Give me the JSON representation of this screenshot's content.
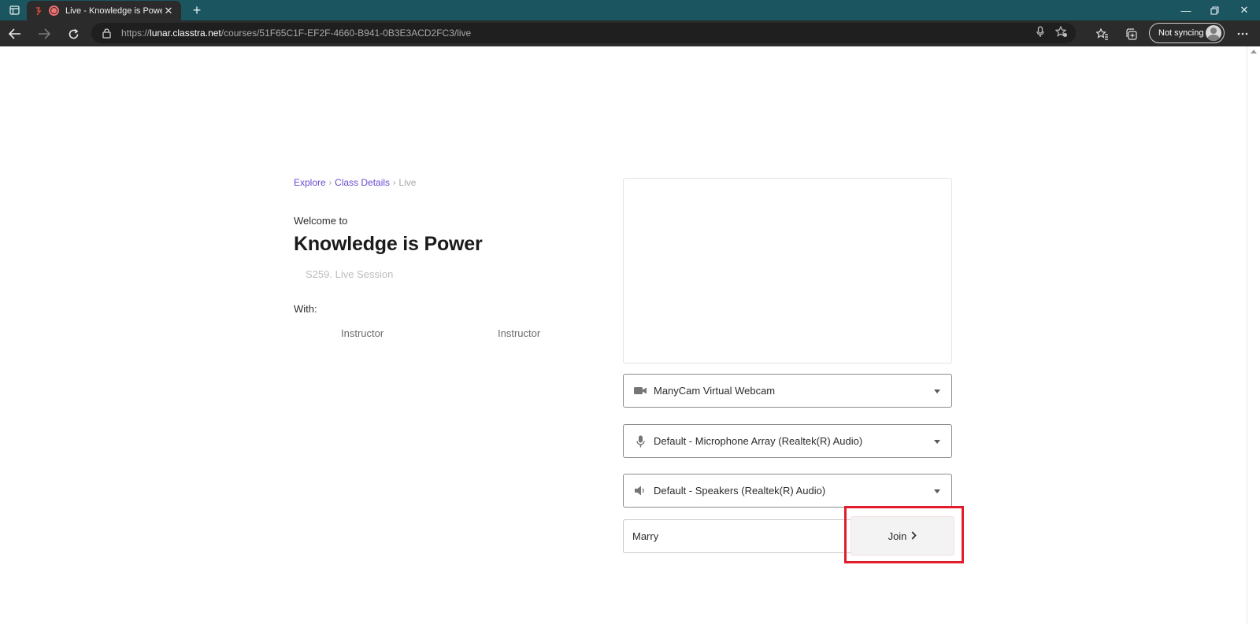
{
  "browser": {
    "tab_title": "Live - Knowledge is Power |",
    "url_scheme": "https://",
    "url_host": "lunar.classtra.net",
    "url_path": "/courses/51F65C1F-EF2F-4660-B941-0B3E3ACD2FC3/live",
    "sync_label": "Not syncing"
  },
  "breadcrumb": {
    "items": [
      "Explore",
      "Class Details",
      "Live"
    ],
    "separator": "›"
  },
  "course": {
    "welcome": "Welcome to",
    "title": "Knowledge is Power",
    "session": "S259. Live Session",
    "with_label": "With:",
    "instructors": [
      "Instructor",
      "Instructor"
    ]
  },
  "devices": {
    "camera": "ManyCam Virtual Webcam",
    "microphone": "Default - Microphone Array (Realtek(R) Audio)",
    "speaker": "Default - Speakers (Realtek(R) Audio)"
  },
  "join": {
    "name_value": "Marry",
    "button_label": "Join",
    "highlight_color": "#e11d2a"
  },
  "colors": {
    "tabbar": "#1a5560",
    "link": "#6a4ccf"
  }
}
